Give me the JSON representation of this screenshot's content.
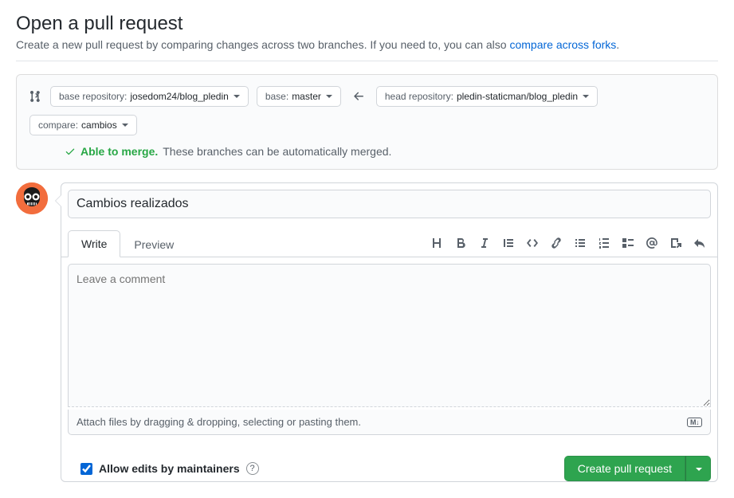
{
  "header": {
    "title": "Open a pull request",
    "subtitle_prefix": "Create a new pull request by comparing changes across two branches. If you need to, you can also ",
    "subtitle_link": "compare across forks",
    "subtitle_suffix": "."
  },
  "compare": {
    "base_repo_label": "base repository: ",
    "base_repo_value": "josedom24/blog_pledin",
    "base_branch_label": "base: ",
    "base_branch_value": "master",
    "head_repo_label": "head repository: ",
    "head_repo_value": "pledin-staticman/blog_pledin",
    "compare_branch_label": "compare: ",
    "compare_branch_value": "cambios"
  },
  "merge": {
    "strong": "Able to merge.",
    "rest": "These branches can be automatically merged."
  },
  "form": {
    "title_value": "Cambios realizados",
    "tabs": {
      "write": "Write",
      "preview": "Preview"
    },
    "comment_placeholder": "Leave a comment",
    "attach_hint": "Attach files by dragging & dropping, selecting or pasting them.",
    "md_badge": "M↓",
    "allow_edits_label": "Allow edits by maintainers",
    "create_button": "Create pull request"
  }
}
